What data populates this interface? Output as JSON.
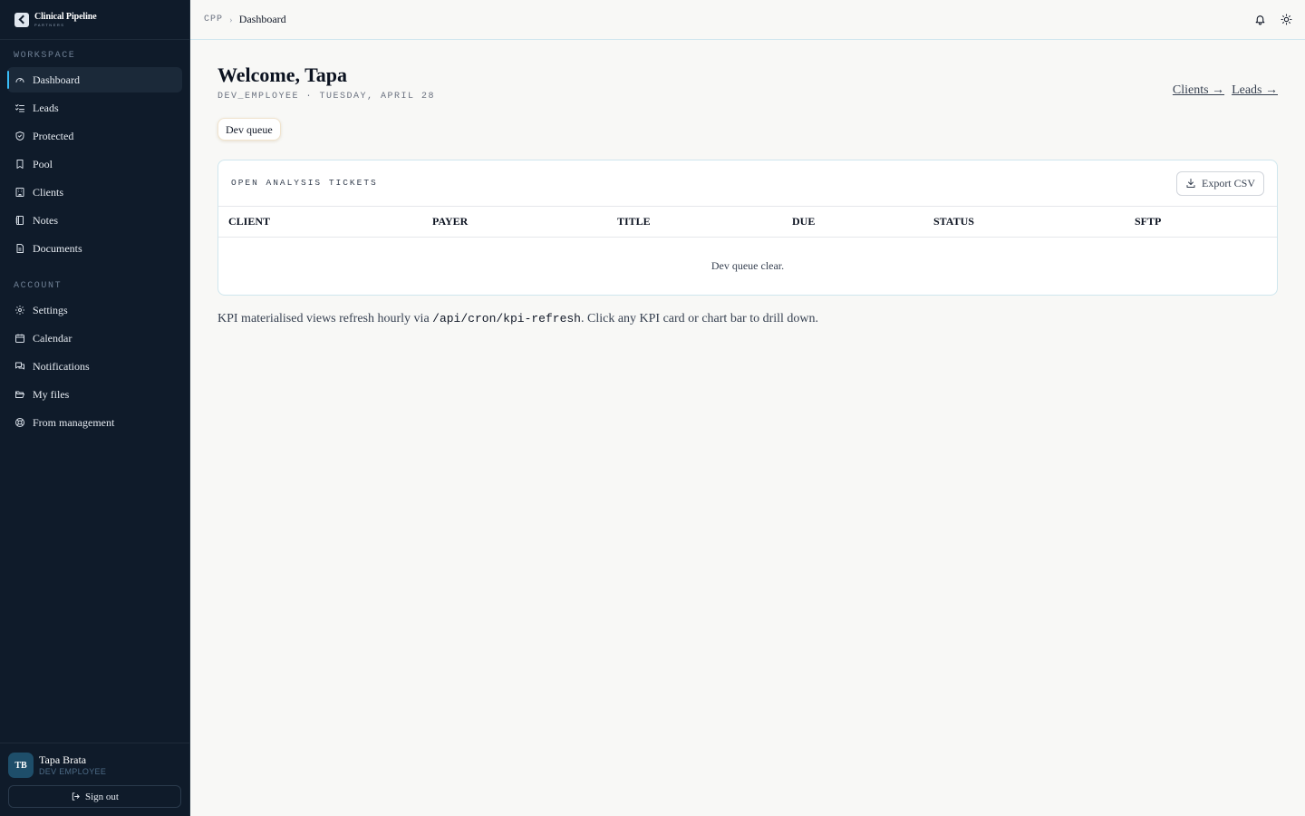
{
  "brand": {
    "name": "Clinical Pipeline",
    "sub": "PARTNERS"
  },
  "sidebar": {
    "workspace_label": "WORKSPACE",
    "workspace_items": [
      {
        "label": "Dashboard",
        "icon": "gauge-icon",
        "active": true
      },
      {
        "label": "Leads",
        "icon": "list-checks-icon"
      },
      {
        "label": "Protected",
        "icon": "shield-check-icon"
      },
      {
        "label": "Pool",
        "icon": "bookmark-icon"
      },
      {
        "label": "Clients",
        "icon": "building-icon"
      },
      {
        "label": "Notes",
        "icon": "notebook-icon"
      },
      {
        "label": "Documents",
        "icon": "file-text-icon"
      }
    ],
    "account_label": "ACCOUNT",
    "account_items": [
      {
        "label": "Settings",
        "icon": "gear-icon"
      },
      {
        "label": "Calendar",
        "icon": "calendar-icon"
      },
      {
        "label": "Notifications",
        "icon": "messages-icon"
      },
      {
        "label": "My files",
        "icon": "folder-open-icon"
      },
      {
        "label": "From management",
        "icon": "life-buoy-icon"
      }
    ]
  },
  "user": {
    "initials": "TB",
    "name": "Tapa Brata",
    "role": "DEV EMPLOYEE",
    "signout_label": "Sign out"
  },
  "topbar": {
    "crumb_root": "CPP",
    "crumb_current": "Dashboard"
  },
  "main": {
    "welcome": "Welcome, Tapa",
    "subline": "DEV_EMPLOYEE · TUESDAY, APRIL 28",
    "links": {
      "clients": "Clients →",
      "leads": "Leads →"
    },
    "tab": "Dev queue",
    "card": {
      "title": "OPEN ANALYSIS TICKETS",
      "export_label": "Export CSV",
      "columns": [
        "CLIENT",
        "PAYER",
        "TITLE",
        "DUE",
        "STATUS",
        "SFTP"
      ],
      "empty": "Dev queue clear."
    },
    "footnote": {
      "before": "KPI materialised views refresh hourly via ",
      "code": "/api/cron/kpi-refresh",
      "after": ". Click any KPI card or chart bar to drill down."
    }
  }
}
